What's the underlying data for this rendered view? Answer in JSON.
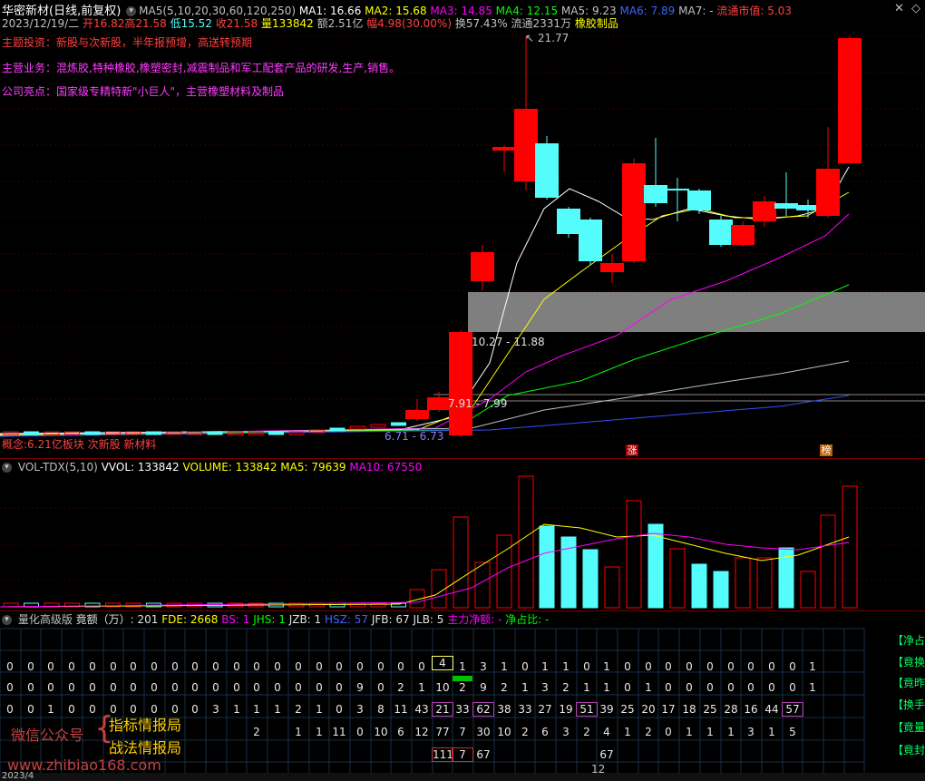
{
  "header": {
    "stock_name": "华密新材",
    "period": "(日线,前复权)",
    "ma_label": "MA5(5,10,20,30,60,120,250)",
    "ma1": "MA1: 16.66",
    "ma2": "MA2: 15.68",
    "ma3": "MA3: 14.85",
    "ma4": "MA4: 12.15",
    "ma5": "MA5: 9.23",
    "ma6": "MA6: 7.89",
    "ma7": "MA7: -",
    "float_cap": "流通市值: 5.03",
    "date": "2023/12/19/二",
    "open": "开16.82",
    "high": "高21.58",
    "low": "低15.52",
    "close": "收21.58",
    "volume": "量133842",
    "amount": "额2.51亿",
    "change": "幅4.98(30.00%)",
    "turnover": "换57.43%",
    "float_shares": "流通2331万",
    "industry": "橡胶制品"
  },
  "info": {
    "theme": "主题投资：新股与次新股，半年报预增，高送转预期",
    "business": "主营业务：混炼胶,特种橡胶,橡塑密封,减震制品和军工配套产品的研发,生产,销售。",
    "highlight": "公司亮点：国家级专精特新\"小巨人\"，主营橡塑材料及制品"
  },
  "price_labels": {
    "high": "21.77",
    "zone1": "10.27 - 11.88",
    "zone2": "7.91 - 7.99",
    "zone3": "6.71 - 6.73",
    "sector": "概念:6.21亿板块 次新股 新材料",
    "badge1": "涨",
    "badge2": "榜"
  },
  "volume_panel": {
    "title": "VOL-TDX(5,10)",
    "vvol": "VVOL: 133842",
    "volume": "VOLUME: 133842",
    "ma5": "MA5: 79639",
    "ma10": "MA10: 67550"
  },
  "quant_panel": {
    "title": "量化高级版",
    "jinge": "竟额（万）: 201",
    "fde": "FDE: 2668",
    "bs": "BS: 1",
    "jhs": "JHS: 1",
    "jzb": "JZB: 1",
    "hsz": "HSZ: 57",
    "jfb": "JFB: 67",
    "jlb": "JLB: 5",
    "main_flow": "主力净额: -",
    "net_ratio": "净占比: -",
    "rows": [
      [
        "0",
        "0",
        "0",
        "0",
        "0",
        "0",
        "0",
        "0",
        "0",
        "0",
        "0",
        "0",
        "0",
        "0",
        "0",
        "0",
        "0",
        "0",
        "0",
        "0",
        "0",
        "4",
        "1",
        "3",
        "1",
        "0",
        "1",
        "1",
        "0",
        "1",
        "0",
        "0",
        "0",
        "0",
        "0",
        "0",
        "0",
        "0",
        "0",
        "1"
      ],
      [
        "0",
        "0",
        "0",
        "0",
        "0",
        "0",
        "0",
        "0",
        "0",
        "0",
        "0",
        "0",
        "0",
        "0",
        "0",
        "0",
        "0",
        "9",
        "0",
        "2",
        "1",
        "10",
        "2",
        "9",
        "2",
        "1",
        "3",
        "2",
        "1",
        "1",
        "0",
        "1",
        "0",
        "0",
        "0",
        "0",
        "0",
        "0",
        "0",
        "1"
      ],
      [
        "0",
        "0",
        "1",
        "0",
        "0",
        "0",
        "0",
        "0",
        "0",
        "0",
        "3",
        "1",
        "1",
        "1",
        "2",
        "1",
        "0",
        "3",
        "8",
        "11",
        "43",
        "21",
        "33",
        "62",
        "38",
        "33",
        "27",
        "19",
        "51",
        "39",
        "25",
        "20",
        "17",
        "18",
        "25",
        "28",
        "16",
        "44",
        "57",
        ""
      ],
      [
        "",
        "",
        "",
        "",
        "",
        "",
        "",
        "",
        "",
        "",
        "",
        "",
        "2",
        "",
        "1",
        "1",
        "11",
        "0",
        "10",
        "6",
        "12",
        "77",
        "7",
        "30",
        "10",
        "2",
        "6",
        "3",
        "2",
        "4",
        "1",
        "2",
        "0",
        "1",
        "1",
        "1",
        "3",
        "1",
        "5",
        ""
      ],
      [
        "",
        "",
        "",
        "",
        "",
        "",
        "",
        "",
        "",
        "",
        "",
        "",
        "",
        "",
        "",
        "",
        "",
        "",
        "",
        "",
        "",
        "111",
        "7",
        "67",
        "",
        "",
        "",
        "",
        "",
        "67",
        "",
        "",
        "",
        "",
        "",
        "",
        "",
        "",
        "",
        ""
      ]
    ],
    "right_labels": [
      "【净占",
      "【竟换手",
      "【竟昨",
      "【换手",
      "【竟量",
      "【竟封"
    ]
  },
  "watermark": {
    "wechat": "微信公众号",
    "line1": "指标情报局",
    "line2": "战法情报局",
    "site": "www.zhibiao168.com"
  },
  "axis": {
    "year": "2023/4",
    "month": "12"
  },
  "colors": {
    "up": "#ff0000",
    "down": "#54fcfc",
    "ma1": "#ffffff",
    "ma2": "#ffff00",
    "ma3": "#ff00ff",
    "ma4": "#00ff00",
    "ma5": "#c0c0c0",
    "ma6": "#3050ff"
  }
}
